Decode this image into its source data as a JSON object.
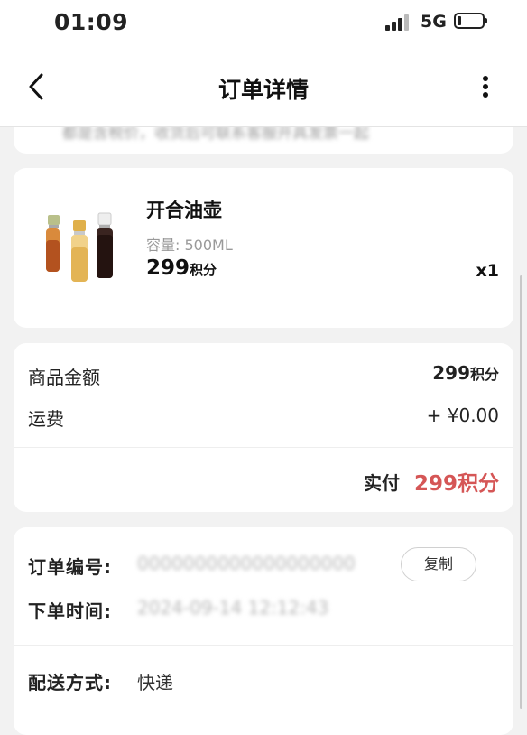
{
  "status_bar": {
    "time": "01:09",
    "network": "5G"
  },
  "nav": {
    "title": "订单详情"
  },
  "partial_notice": {
    "text": "都是含税价，收货后可联系客服开具发票一起"
  },
  "product": {
    "name": "开合油壶",
    "spec": "容量: 500ML",
    "price": "299",
    "price_unit": "积分",
    "quantity": "x1"
  },
  "summary": {
    "goods_label": "商品金额",
    "goods_value": "299",
    "goods_unit": "积分",
    "shipping_label": "运费",
    "shipping_value": "+ ¥0.00",
    "paid_label": "实付",
    "paid_value": "299积分"
  },
  "order_info": {
    "order_no_label": "订单编号:",
    "order_no_value": "0000000000000000000",
    "copy_label": "复制",
    "order_time_label": "下单时间:",
    "order_time_value": "2024-09-14 12:12:43",
    "delivery_label": "配送方式:",
    "delivery_value": "快递"
  },
  "colors": {
    "accent": "#d55656",
    "background": "#f2f2f2"
  }
}
